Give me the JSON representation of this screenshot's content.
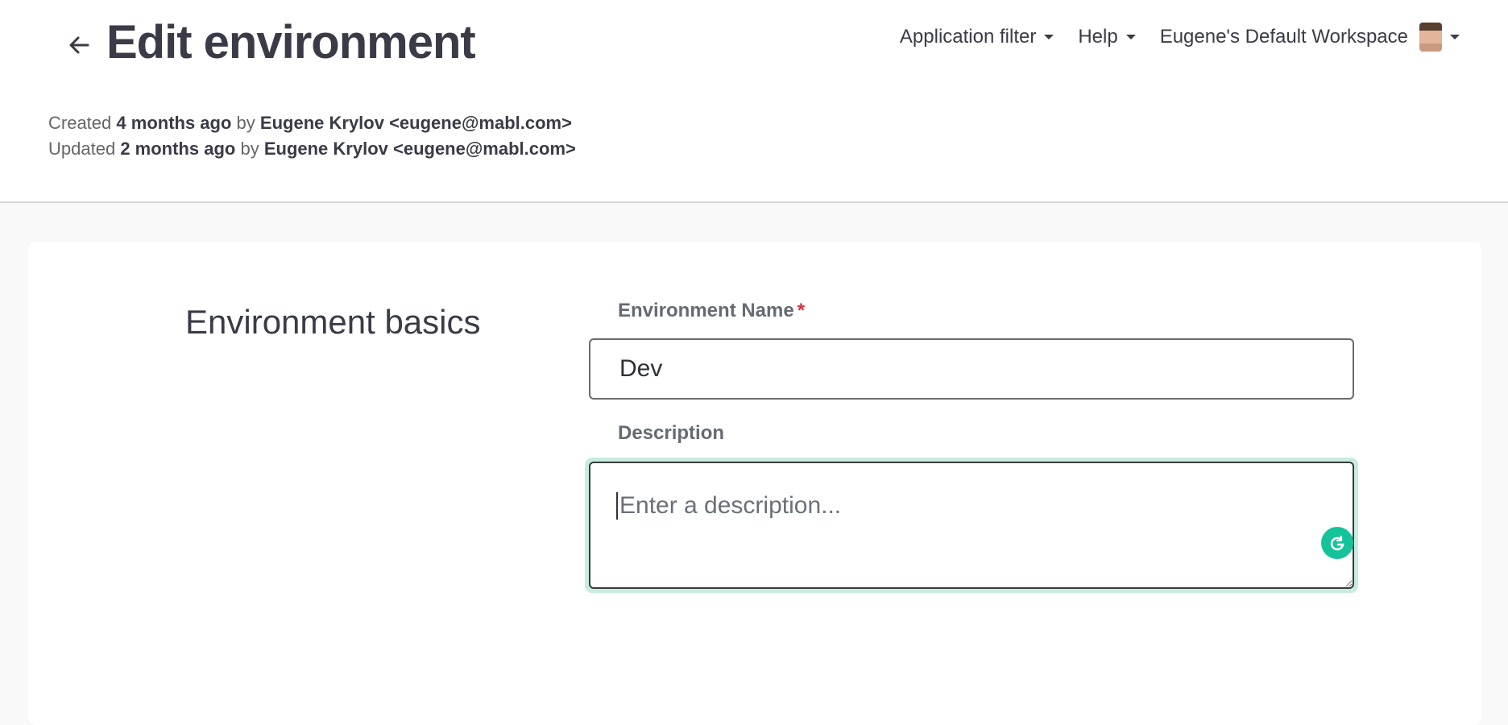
{
  "header": {
    "title": "Edit environment",
    "created": {
      "prefix": "Created",
      "when": "4 months ago",
      "by": "by",
      "author": "Eugene Krylov <eugene@mabl.com>"
    },
    "updated": {
      "prefix": "Updated",
      "when": "2 months ago",
      "by": "by",
      "author": "Eugene Krylov <eugene@mabl.com>"
    }
  },
  "nav": {
    "app_filter_label": "Application filter",
    "help_label": "Help",
    "workspace_label": "Eugene's Default Workspace"
  },
  "form": {
    "section_title": "Environment basics",
    "name_label": "Environment Name",
    "name_required_mark": "*",
    "name_value": "Dev",
    "description_label": "Description",
    "description_value": "",
    "description_placeholder": "Enter a description..."
  },
  "icons": {
    "back": "arrow-left-icon",
    "caret": "chevron-down-icon",
    "grammarly": "grammarly-icon"
  },
  "colors": {
    "focus_ring": "#c7ece0",
    "grammarly": "#15c39a",
    "required": "#d0313a"
  }
}
